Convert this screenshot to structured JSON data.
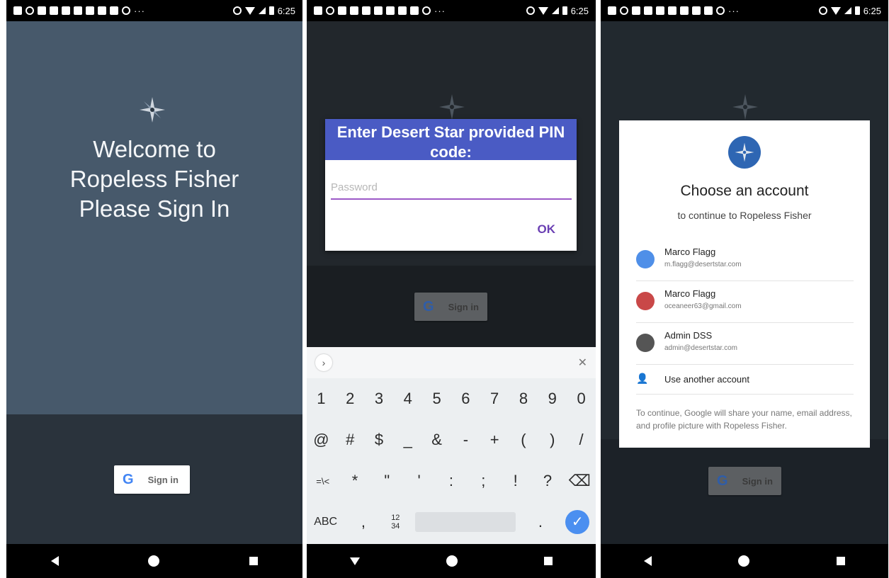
{
  "status_bar": {
    "time": "6:25",
    "dots": "···"
  },
  "screen1": {
    "welcome_lines": [
      "Welcome to",
      "Ropeless Fisher",
      "Please Sign In"
    ],
    "sign_in_label": "Sign in",
    "google_glyph": "G"
  },
  "screen2": {
    "dialog_title": "Enter Desert Star provided PIN code:",
    "password_placeholder": "Password",
    "ok_label": "OK",
    "sign_in_label": "Sign in",
    "google_glyph": "G",
    "keyboard": {
      "row1": [
        "1",
        "2",
        "3",
        "4",
        "5",
        "6",
        "7",
        "8",
        "9",
        "0"
      ],
      "row2": [
        "@",
        "#",
        "$",
        "_",
        "&",
        "-",
        "+",
        "(",
        ")",
        "/"
      ],
      "row3": [
        "=\\<",
        "*",
        "\"",
        "'",
        ":",
        ";",
        "!",
        "?",
        "⌫"
      ],
      "abc_label": "ABC",
      "comma": ",",
      "numpad_label": "12 34",
      "period": ".",
      "enter_glyph": "✓"
    }
  },
  "screen3": {
    "title": "Choose an account",
    "subtitle": "to continue to Ropeless Fisher",
    "accounts": [
      {
        "name": "Marco Flagg",
        "email": "m.flagg@desertstar.com",
        "avatar_color": "#4f8fe8"
      },
      {
        "name": "Marco Flagg",
        "email": "oceaneer63@gmail.com",
        "avatar_color": "#c94848"
      },
      {
        "name": "Admin DSS",
        "email": "admin@desertstar.com",
        "avatar_color": "#555555"
      }
    ],
    "use_another_label": "Use another account",
    "disclaimer": "To continue, Google will share your name, email address, and profile picture with Ropeless Fisher.",
    "sign_in_label": "Sign in",
    "google_glyph": "G"
  }
}
